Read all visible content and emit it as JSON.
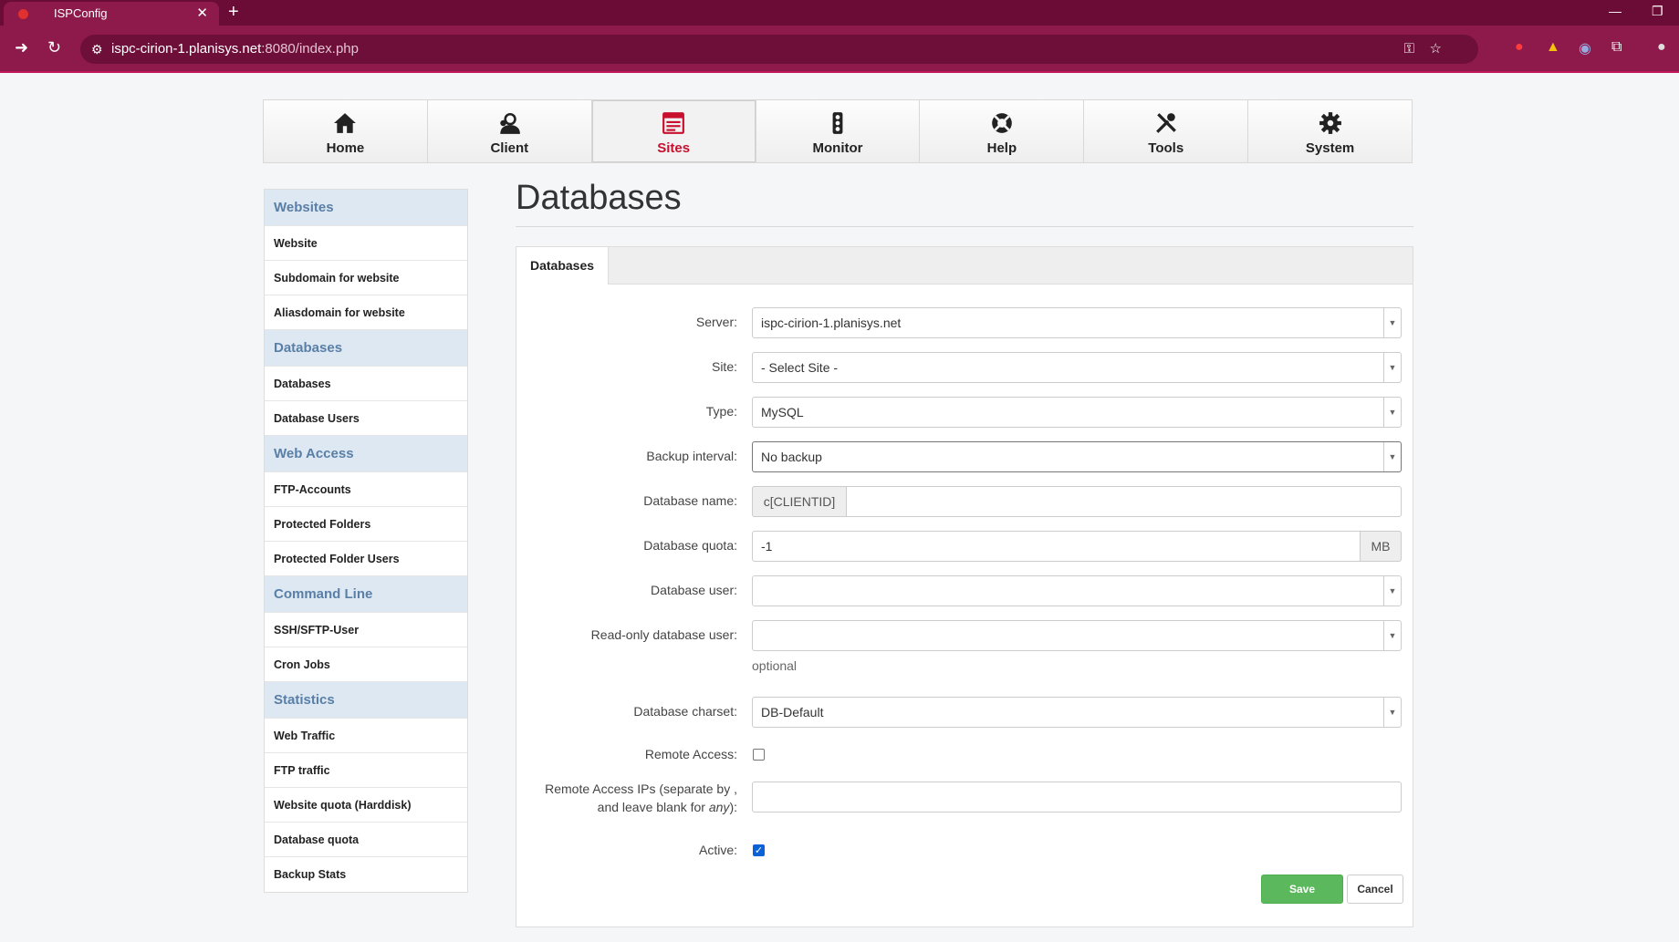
{
  "browser": {
    "tab_title": "ISPConfig",
    "tab_close": "✕",
    "new_tab": "+",
    "url_host": "ispc-cirion-1.planisys.net",
    "url_path": ":8080/index.php",
    "win_minimize": "—",
    "win_restore": "❐"
  },
  "topnav": {
    "items": [
      {
        "label": "Home",
        "icon": "home-icon"
      },
      {
        "label": "Client",
        "icon": "client-icon"
      },
      {
        "label": "Sites",
        "icon": "sites-icon",
        "active": true
      },
      {
        "label": "Monitor",
        "icon": "monitor-icon"
      },
      {
        "label": "Help",
        "icon": "help-icon"
      },
      {
        "label": "Tools",
        "icon": "tools-icon"
      },
      {
        "label": "System",
        "icon": "system-icon"
      }
    ],
    "active_color": "#c8102e"
  },
  "sidebar": {
    "sections": [
      {
        "title": "Websites",
        "items": [
          "Website",
          "Subdomain for website",
          "Aliasdomain for website"
        ]
      },
      {
        "title": "Databases",
        "items": [
          "Databases",
          "Database Users"
        ]
      },
      {
        "title": "Web Access",
        "items": [
          "FTP-Accounts",
          "Protected Folders",
          "Protected Folder Users"
        ]
      },
      {
        "title": "Command Line",
        "items": [
          "SSH/SFTP-User",
          "Cron Jobs"
        ]
      },
      {
        "title": "Statistics",
        "items": [
          "Web Traffic",
          "FTP traffic",
          "Website quota (Harddisk)",
          "Database quota",
          "Backup Stats"
        ]
      }
    ]
  },
  "main": {
    "title": "Databases",
    "tab_label": "Databases",
    "form": {
      "server_label": "Server:",
      "server_value": "ispc-cirion-1.planisys.net",
      "site_label": "Site:",
      "site_value": "- Select Site -",
      "type_label": "Type:",
      "type_value": "MySQL",
      "backup_label": "Backup interval:",
      "backup_value": "No backup",
      "dbname_label": "Database name:",
      "dbname_prefix": "c[CLIENTID]",
      "dbname_value": "",
      "quota_label": "Database quota:",
      "quota_value": "-1",
      "quota_unit": "MB",
      "dbuser_label": "Database user:",
      "dbuser_value": "",
      "rouser_label": "Read-only database user:",
      "rouser_value": "",
      "rouser_hint": "optional",
      "charset_label": "Database charset:",
      "charset_value": "DB-Default",
      "remote_label": "Remote Access:",
      "remote_checked": false,
      "remote_ips_label_1": "Remote Access IPs (separate by ,",
      "remote_ips_label_2": "and leave blank for ",
      "remote_ips_label_any": "any",
      "remote_ips_label_end": "):",
      "remote_ips_value": "",
      "active_label": "Active:",
      "active_checked": true
    },
    "save_label": "Save",
    "cancel_label": "Cancel"
  },
  "colors": {
    "save": "#5cb85c",
    "sidebar_head": "#dde8f3",
    "browser_bar": "#8d1a4a"
  }
}
